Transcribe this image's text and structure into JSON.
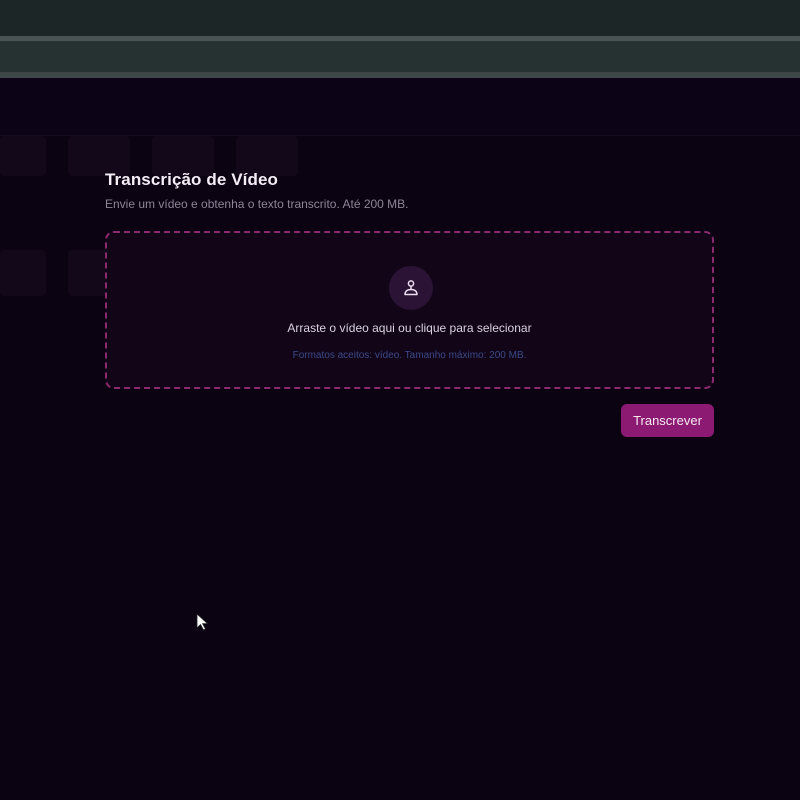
{
  "card": {
    "title": "Transcrição de Vídeo",
    "subtitle": "Envie um vídeo e obtenha o texto transcrito. Até 200 MB."
  },
  "dropzone": {
    "icon": "upload-hand-icon",
    "text": "Arraste o vídeo aqui ou clique para selecionar",
    "hint": "Formatos aceitos: vídeo. Tamanho máximo: 200 MB."
  },
  "actions": {
    "submit_label": "Transcrever"
  },
  "colors": {
    "accent": "#8c1a72",
    "dashed_border": "#8c2a6e",
    "background": "#0b0212",
    "hint_text": "#3b4a88"
  }
}
